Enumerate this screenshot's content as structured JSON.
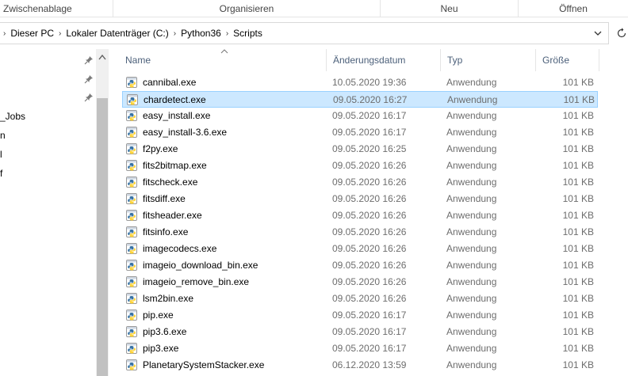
{
  "ribbon": {
    "groups": [
      "Zwischenablage",
      "Organisieren",
      "Neu",
      "Öffnen"
    ]
  },
  "address": {
    "crumbs": [
      "Dieser PC",
      "Lokaler Datenträger (C:)",
      "Python36",
      "Scripts"
    ]
  },
  "nav": {
    "items": [
      "_Jobs",
      "n",
      "l",
      "f"
    ]
  },
  "columns": {
    "name": "Name",
    "date": "Änderungsdatum",
    "type": "Typ",
    "size": "Größe"
  },
  "files": [
    {
      "name": "cannibal.exe",
      "date": "10.05.2020 19:36",
      "type": "Anwendung",
      "size": "101 KB"
    },
    {
      "name": "chardetect.exe",
      "date": "09.05.2020 16:27",
      "type": "Anwendung",
      "size": "101 KB"
    },
    {
      "name": "easy_install.exe",
      "date": "09.05.2020 16:17",
      "type": "Anwendung",
      "size": "101 KB"
    },
    {
      "name": "easy_install-3.6.exe",
      "date": "09.05.2020 16:17",
      "type": "Anwendung",
      "size": "101 KB"
    },
    {
      "name": "f2py.exe",
      "date": "09.05.2020 16:25",
      "type": "Anwendung",
      "size": "101 KB"
    },
    {
      "name": "fits2bitmap.exe",
      "date": "09.05.2020 16:26",
      "type": "Anwendung",
      "size": "101 KB"
    },
    {
      "name": "fitscheck.exe",
      "date": "09.05.2020 16:26",
      "type": "Anwendung",
      "size": "101 KB"
    },
    {
      "name": "fitsdiff.exe",
      "date": "09.05.2020 16:26",
      "type": "Anwendung",
      "size": "101 KB"
    },
    {
      "name": "fitsheader.exe",
      "date": "09.05.2020 16:26",
      "type": "Anwendung",
      "size": "101 KB"
    },
    {
      "name": "fitsinfo.exe",
      "date": "09.05.2020 16:26",
      "type": "Anwendung",
      "size": "101 KB"
    },
    {
      "name": "imagecodecs.exe",
      "date": "09.05.2020 16:26",
      "type": "Anwendung",
      "size": "101 KB"
    },
    {
      "name": "imageio_download_bin.exe",
      "date": "09.05.2020 16:26",
      "type": "Anwendung",
      "size": "101 KB"
    },
    {
      "name": "imageio_remove_bin.exe",
      "date": "09.05.2020 16:26",
      "type": "Anwendung",
      "size": "101 KB"
    },
    {
      "name": "lsm2bin.exe",
      "date": "09.05.2020 16:26",
      "type": "Anwendung",
      "size": "101 KB"
    },
    {
      "name": "pip.exe",
      "date": "09.05.2020 16:17",
      "type": "Anwendung",
      "size": "101 KB"
    },
    {
      "name": "pip3.6.exe",
      "date": "09.05.2020 16:17",
      "type": "Anwendung",
      "size": "101 KB"
    },
    {
      "name": "pip3.exe",
      "date": "09.05.2020 16:17",
      "type": "Anwendung",
      "size": "101 KB"
    },
    {
      "name": "PlanetarySystemStacker.exe",
      "date": "06.12.2020 13:59",
      "type": "Anwendung",
      "size": "101 KB"
    }
  ],
  "selected_index": 1,
  "colors": {
    "selection_bg": "#cce8ff",
    "selection_border": "#99d1ff",
    "header_text": "#4c607a",
    "meta_text": "#6d6d6d",
    "python_blue": "#3772a4",
    "python_yellow": "#ffd43b"
  },
  "icons": {
    "file": "python-exe-icon",
    "pin": "pin-icon",
    "refresh": "refresh-icon",
    "dropdown": "chevron-down-icon",
    "separator": "chevron-right-icon",
    "sort": "sort-ascending-icon",
    "scroll_up": "scroll-up-arrow-icon"
  }
}
